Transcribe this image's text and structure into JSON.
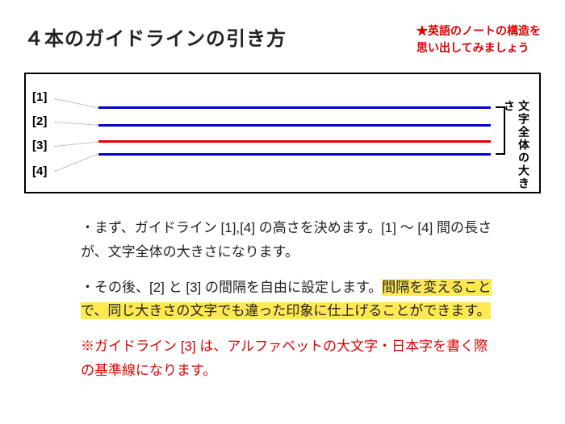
{
  "header": {
    "title": "４本のガイドラインの引き方",
    "note_line1": "★英語のノートの構造を",
    "note_line2": "思い出してみましょう"
  },
  "diagram": {
    "labels": {
      "l1": "[1]",
      "l2": "[2]",
      "l3": "[3]",
      "l4": "[4]"
    },
    "side_label": "文字全体の大きさ"
  },
  "body": {
    "p1": "・まず、ガイドライン [1],[4] の高さを決めます。[1] ～ [4] 間の長さが、文字全体の大きさになります。",
    "p2_a": "・その後、[2] と [3] の間隔を自由に設定します。",
    "p2_hl": "間隔を変えることで、同じ大きさの文字でも違った印象に仕上げることができます。",
    "p3": "※ガイドライン [3] は、アルファベットの大文字・日本字を書く際の基準線になります。"
  }
}
